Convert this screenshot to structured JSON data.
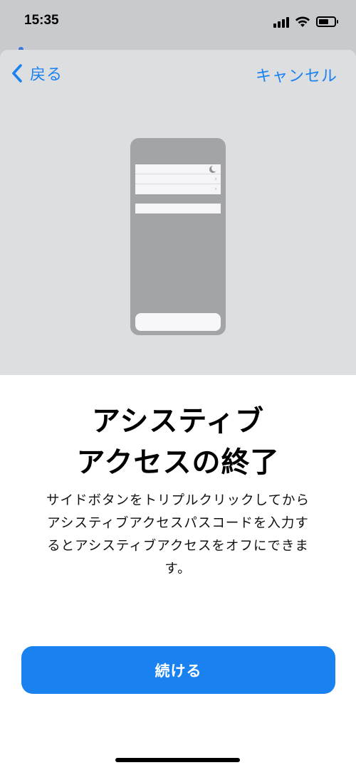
{
  "status_bar": {
    "time": "15:35",
    "icons": [
      "signal-icon",
      "wifi-icon",
      "battery-icon"
    ]
  },
  "nav": {
    "back_label": "戻る",
    "cancel_label": "キャンセル"
  },
  "content": {
    "title_line1": "アシスティブ",
    "title_line2": "アクセスの終了",
    "description": "サイドボタンをトリプルクリックしてからアシスティブアクセスパスコードを入力するとアシスティブアクセスをオフにできます。"
  },
  "actions": {
    "continue_label": "続ける"
  },
  "colors": {
    "accent": "#1a82f0",
    "hero_background": "#dddee0",
    "sheet_background": "#ffffff"
  }
}
